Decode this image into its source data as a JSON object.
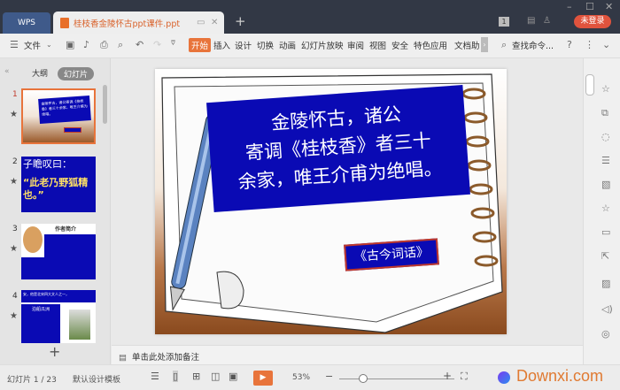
{
  "window": {
    "app_tab": "WPS",
    "doc_tab": "桂枝香金陵怀古ppt课件.ppt",
    "new_tab": "+",
    "badge": "1",
    "login": "未登录"
  },
  "toolbar": {
    "file": "文件",
    "items": [
      "开始",
      "插入",
      "设计",
      "切换",
      "动画",
      "幻灯片放映",
      "审阅",
      "视图",
      "安全",
      "特色应用",
      "文档助"
    ],
    "search": "查找命令..."
  },
  "left_panel": {
    "tabs": [
      "大纲",
      "幻灯片"
    ],
    "active_tab": "幻灯片",
    "add": "+",
    "thumbs": [
      {
        "num": "1",
        "text": "金陵怀古，诸公寄调《桂枝香》者三十余家，唯王介甫为绝唱。"
      },
      {
        "num": "2",
        "line1": "子瞻叹曰：",
        "line2": "“此老乃野狐精也。”"
      },
      {
        "num": "3",
        "title": "作者简介"
      },
      {
        "num": "4",
        "line1": "安，他是北宋四大文人之一，",
        "title": "泊船瓜洲"
      }
    ]
  },
  "slide": {
    "main_text": [
      "金陵怀古，诸公",
      "寄调《桂枝香》者三十",
      "余家，唯王介甫为绝唱。"
    ],
    "label": "《古今词话》",
    "colors": {
      "box": "#0a0ab4",
      "label_border": "#c0392b"
    }
  },
  "notes": {
    "placeholder": "单击此处添加备注"
  },
  "status": {
    "slide_counter": "幻灯片 1 / 23",
    "template": "默认设计模板",
    "zoom": "53%",
    "zoom_level": 53,
    "watermark": "Downxi.com"
  }
}
